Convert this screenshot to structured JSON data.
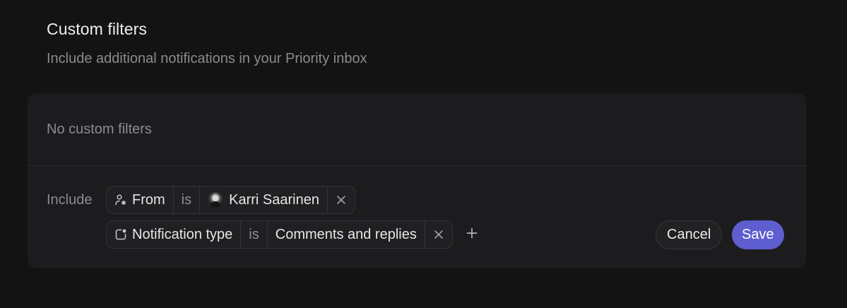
{
  "section": {
    "title": "Custom filters",
    "subtitle": "Include additional notifications in your Priority inbox"
  },
  "card": {
    "empty_text": "No custom filters",
    "include_label": "Include",
    "filters": [
      {
        "field_icon": "person-icon",
        "field": "From",
        "operator": "is",
        "value": "Karri Saarinen",
        "value_icon": "avatar"
      },
      {
        "field_icon": "notification-icon",
        "field": "Notification type",
        "operator": "is",
        "value": "Comments and replies"
      }
    ],
    "add_icon": "plus-icon",
    "remove_icon": "close-icon"
  },
  "actions": {
    "cancel_label": "Cancel",
    "save_label": "Save"
  },
  "colors": {
    "background": "#131314",
    "card": "#1c1c1e",
    "accent": "#5e5ed0"
  }
}
